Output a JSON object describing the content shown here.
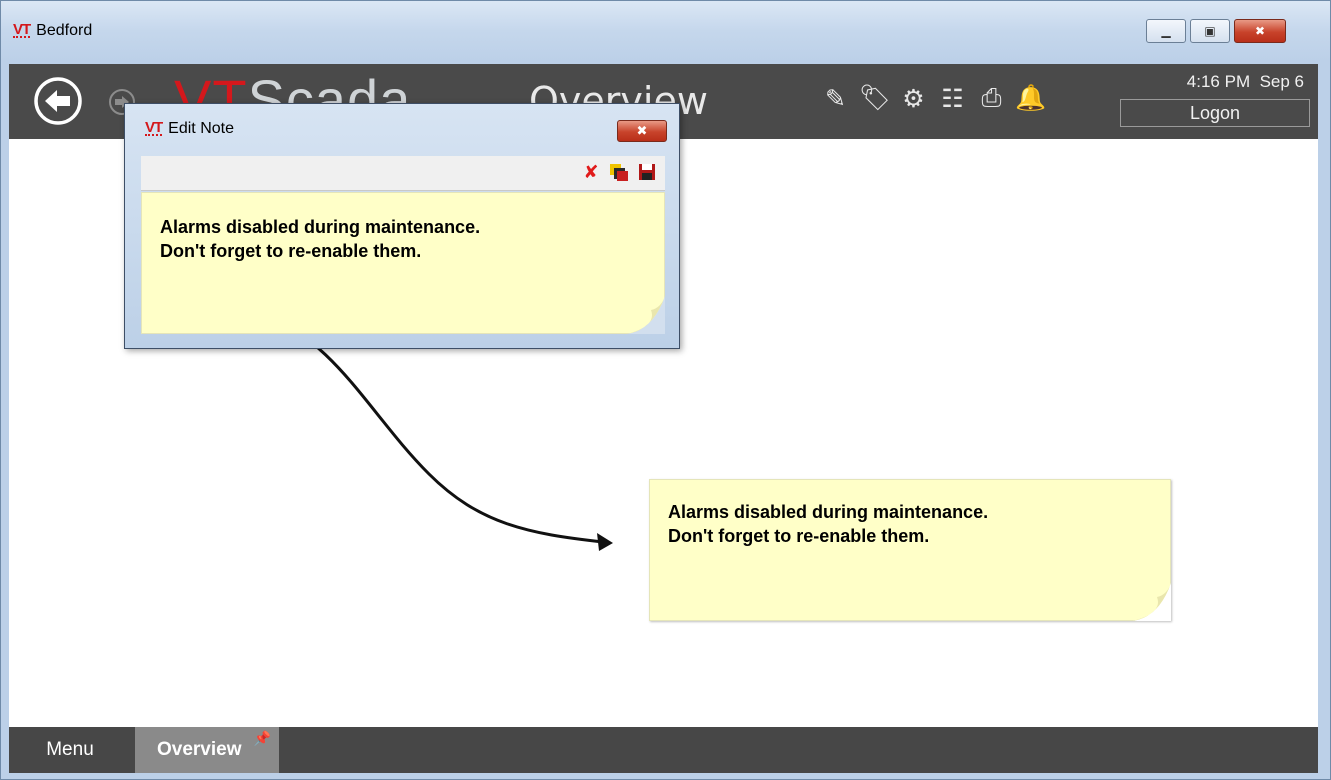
{
  "window": {
    "title": "Bedford",
    "logo": "VT"
  },
  "header": {
    "brand_vt": "VT",
    "brand_rest": "Scada",
    "page_title": "Overview",
    "time": "4:16 PM",
    "date": "Sep 6",
    "logon_label": "Logon",
    "icons": [
      "draw-icon",
      "tag-icon",
      "settings-icon",
      "report-icon",
      "print-icon",
      "alarm-bell-icon"
    ]
  },
  "note": {
    "line1": "Alarms disabled during maintenance.",
    "line2": "Don't forget to re-enable them."
  },
  "edit_dialog": {
    "logo": "VT",
    "title": "Edit Note",
    "toolbar_icons": [
      "delete-icon",
      "color-icon",
      "save-icon"
    ],
    "line1": "Alarms disabled during maintenance.",
    "line2": "Don't forget to re-enable them."
  },
  "footer": {
    "tabs": [
      "Menu",
      "Overview"
    ]
  },
  "colors": {
    "header_bg": "#4a4a4a",
    "note_bg": "#ffffc8",
    "accent": "#d4181c"
  }
}
